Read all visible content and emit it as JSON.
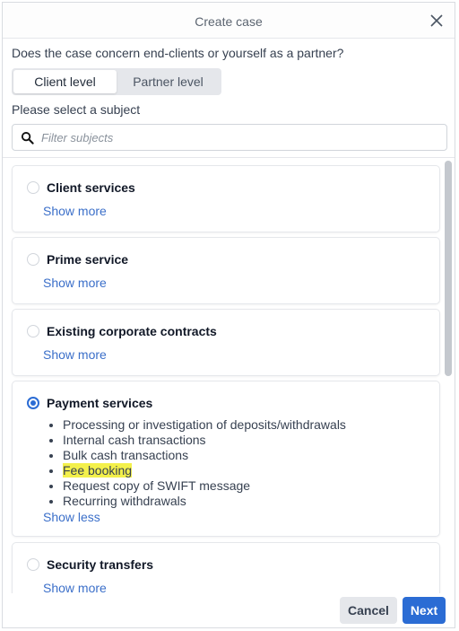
{
  "dialog": {
    "title": "Create case"
  },
  "question": "Does the case concern end-clients or yourself as a partner?",
  "level_toggle": {
    "options": [
      "Client level",
      "Partner level"
    ],
    "selected": "Client level"
  },
  "subject_label": "Please select a subject",
  "search": {
    "placeholder": "Filter subjects",
    "value": ""
  },
  "subjects": [
    {
      "title": "Client services",
      "selected": false,
      "toggle": "Show more"
    },
    {
      "title": "Prime service",
      "selected": false,
      "toggle": "Show more"
    },
    {
      "title": "Existing corporate contracts",
      "selected": false,
      "toggle": "Show more"
    },
    {
      "title": "Payment services",
      "selected": true,
      "toggle": "Show less",
      "items": [
        "Processing or investigation of deposits/withdrawals",
        "Internal cash transactions",
        "Bulk cash transactions",
        "Fee booking",
        "Request copy of SWIFT message",
        "Recurring withdrawals"
      ]
    },
    {
      "title": "Security transfers",
      "selected": false,
      "toggle": "Show more"
    }
  ],
  "footer": {
    "cancel_label": "Cancel",
    "next_label": "Next"
  },
  "colors": {
    "accent": "#2b6cd4",
    "link": "#3b6fc9",
    "highlight": "#f3f04b"
  },
  "icons": {
    "close": "close-icon",
    "search": "search-icon"
  }
}
